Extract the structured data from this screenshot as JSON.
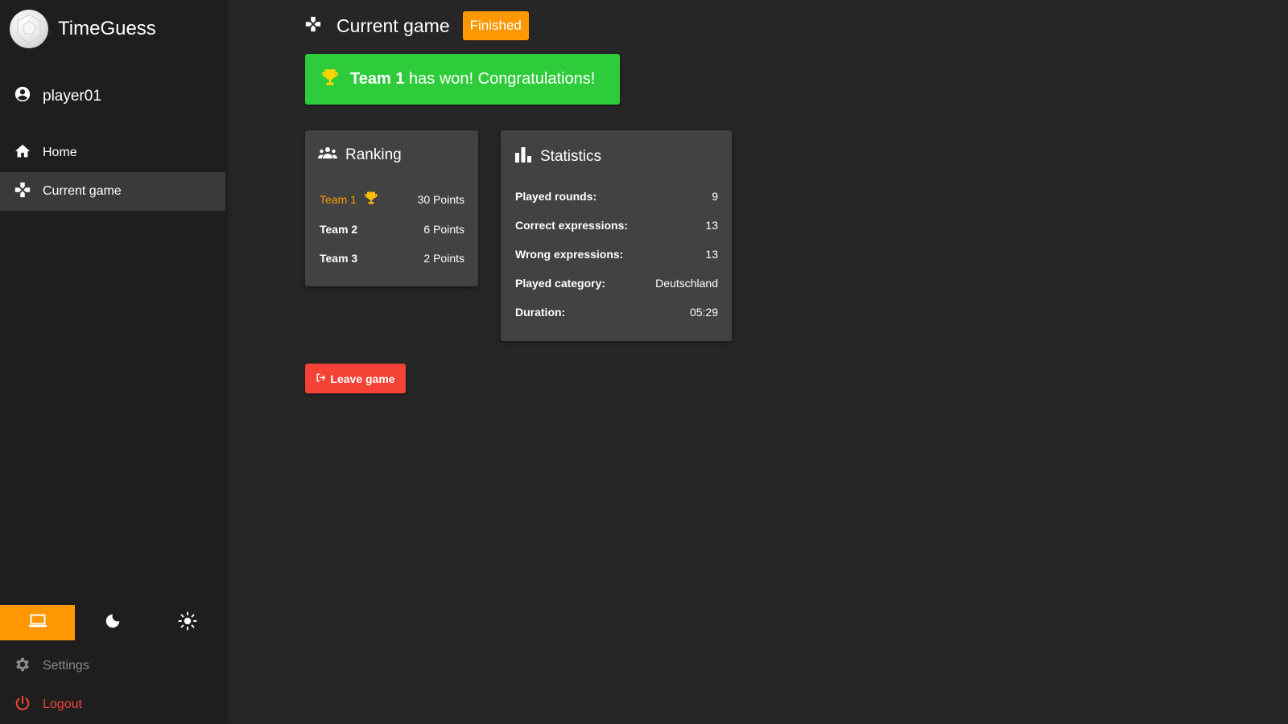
{
  "app": {
    "name": "TimeGuess"
  },
  "user": {
    "name": "player01"
  },
  "nav": {
    "items": [
      {
        "label": "Home",
        "icon": "home-icon"
      },
      {
        "label": "Current game",
        "icon": "gamepad-icon",
        "active": true
      }
    ]
  },
  "theme": {
    "options": [
      {
        "icon": "laptop-icon",
        "active": true
      },
      {
        "icon": "moon-icon",
        "active": false
      },
      {
        "icon": "sun-icon",
        "active": false
      }
    ],
    "accent": "#ff9800"
  },
  "bottom_nav": {
    "settings_label": "Settings",
    "logout_label": "Logout"
  },
  "header": {
    "title": "Current game",
    "status": "Finished"
  },
  "banner": {
    "team": "Team 1",
    "message": "has won! Congratulations!",
    "color": "#2ecc3a"
  },
  "ranking": {
    "title": "Ranking",
    "rows": [
      {
        "team": "Team 1",
        "points": "30 Points",
        "winner": true
      },
      {
        "team": "Team 2",
        "points": "6 Points",
        "winner": false
      },
      {
        "team": "Team 3",
        "points": "2 Points",
        "winner": false
      }
    ]
  },
  "statistics": {
    "title": "Statistics",
    "rows": [
      {
        "label": "Played rounds:",
        "value": "9"
      },
      {
        "label": "Correct expressions:",
        "value": "13"
      },
      {
        "label": "Wrong expressions:",
        "value": "13"
      },
      {
        "label": "Played category:",
        "value": "Deutschland"
      },
      {
        "label": "Duration:",
        "value": "05:29"
      }
    ]
  },
  "actions": {
    "leave_label": "Leave game",
    "leave_color": "#f44336"
  }
}
